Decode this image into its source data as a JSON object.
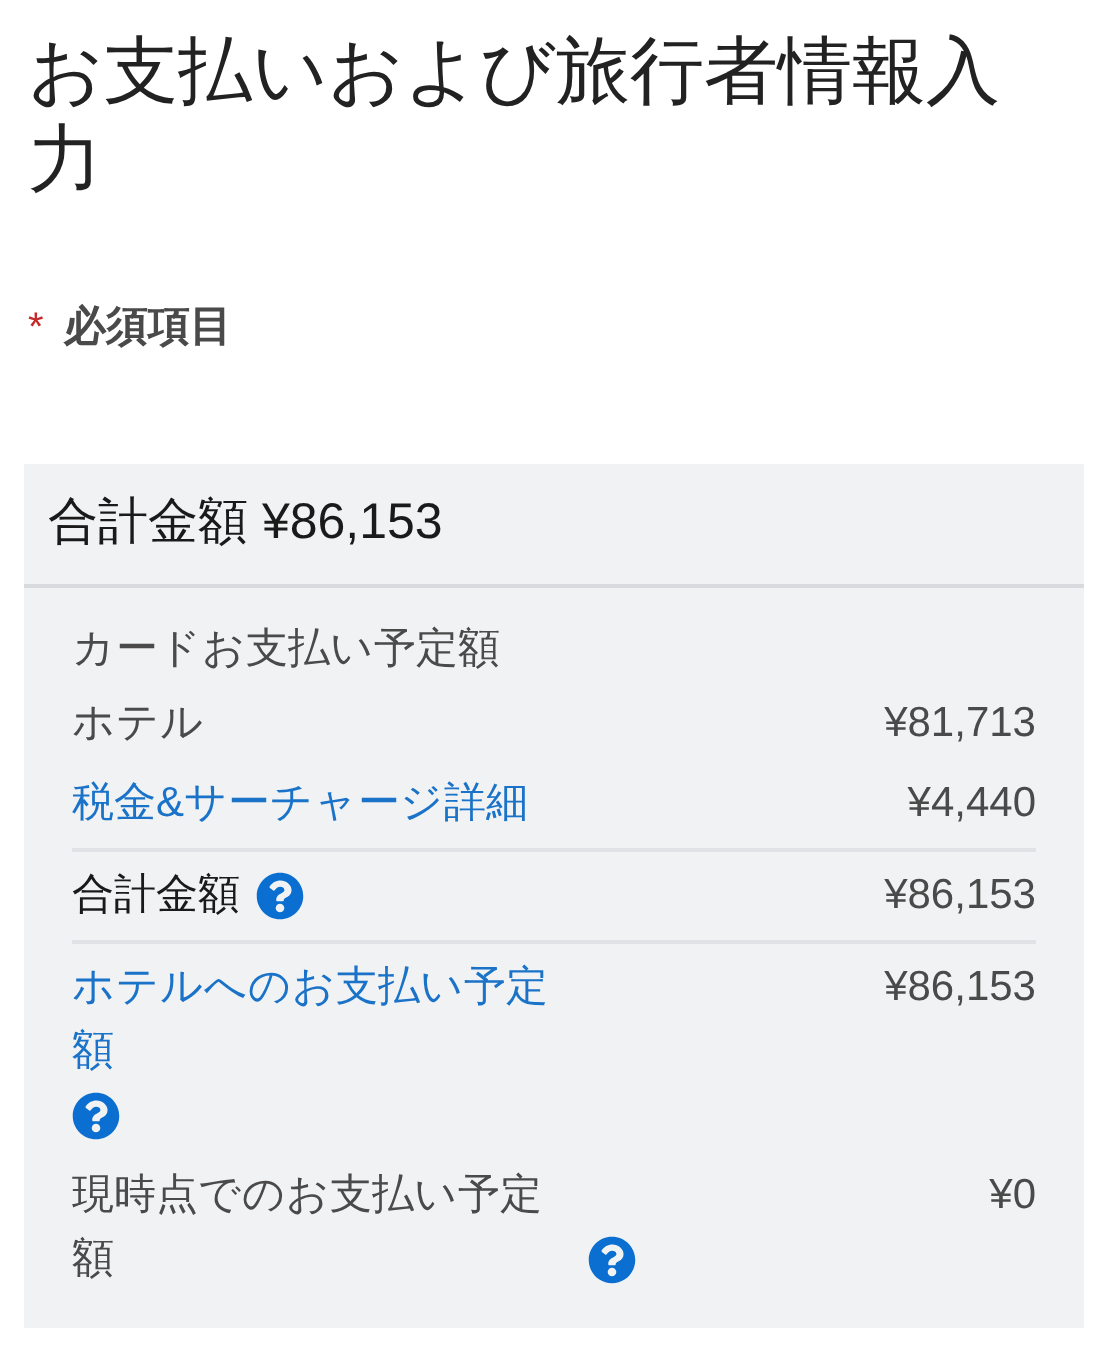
{
  "title": "お支払いおよび旅行者情報入力",
  "required_note": {
    "mark": "*",
    "label": "必須項目"
  },
  "summary": {
    "heading": "合計金額 ¥86,153",
    "groups": [
      {
        "caption": "カードお支払い予定額",
        "rows": [
          {
            "kind": "plain",
            "label": "ホテル",
            "amount": "¥81,713",
            "help": false
          },
          {
            "kind": "link",
            "label": "税金&サーチャージ詳細",
            "amount": "¥4,440",
            "help": false
          }
        ]
      },
      {
        "rows": [
          {
            "kind": "total",
            "label": "合計金額",
            "amount": "¥86,153",
            "help": true
          }
        ]
      },
      {
        "rows": [
          {
            "kind": "link",
            "label": "ホテルへのお支払い予定額",
            "amount": "¥86,153",
            "help": true
          },
          {
            "kind": "plain",
            "label": "現時点でのお支払い予定額",
            "amount": "¥0",
            "help": true
          }
        ]
      }
    ]
  }
}
